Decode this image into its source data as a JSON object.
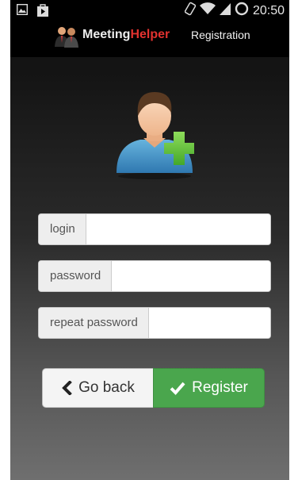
{
  "status_bar": {
    "time": "20:50",
    "left_icons": [
      "image-icon",
      "play-store-icon"
    ],
    "right_icons": [
      "vibrate-icon",
      "wifi-icon",
      "signal-icon",
      "battery-icon"
    ]
  },
  "action_bar": {
    "brand_part1": "Meeting",
    "brand_part2": "Helper",
    "screen_title": "Registration",
    "colors": {
      "brand_red": "#e2322f",
      "background": "#000000"
    }
  },
  "form": {
    "login_label": "login",
    "login_value": "",
    "password_label": "password",
    "password_value": "",
    "repeat_password_label": "repeat password",
    "repeat_password_value": ""
  },
  "buttons": {
    "back_label": "Go back",
    "back_icon": "chevron-left-icon",
    "register_label": "Register",
    "register_icon": "checkmark-icon",
    "register_color": "#4aa64d"
  },
  "avatar_icon": "add-user-icon"
}
